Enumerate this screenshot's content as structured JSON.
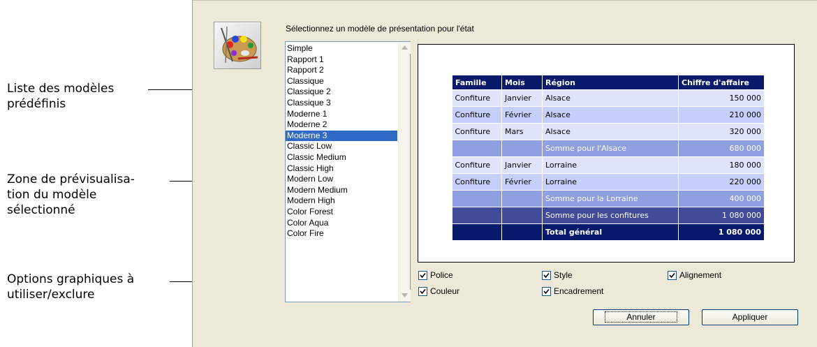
{
  "callouts": {
    "list": [
      "Liste des modèles",
      "prédéfinis"
    ],
    "preview": [
      "Zone de prévisualisa-",
      "tion du modèle",
      "sélectionné"
    ],
    "options": [
      "Options graphiques à",
      "utiliser/exclure"
    ]
  },
  "dialog": {
    "icon": "palette-icon",
    "instruction": "Sélectionnez un modèle de présentation pour l'état",
    "templates": [
      "Simple",
      "Rapport 1",
      "Rapport 2",
      "Classique",
      "Classique 2",
      "Classique 3",
      "Moderne 1",
      "Moderne 2",
      "Moderne 3",
      "Classic Low",
      "Classic Medium",
      "Classic High",
      "Modern Low",
      "Modern Medium",
      "Modern High",
      "Color Forest",
      "Color Aqua",
      "Color Fire"
    ],
    "selected_template": "Moderne 3",
    "preview": {
      "headers": [
        "Famille",
        "Mois",
        "Région",
        "Chiffre d'affaire"
      ],
      "rows": [
        [
          "Confiture",
          "Janvier",
          "Alsace",
          "150 000"
        ],
        [
          "Confiture",
          "Février",
          "Alsace",
          "210 000"
        ],
        [
          "Confiture",
          "Mars",
          "Alsace",
          "320 000"
        ],
        [
          "",
          "",
          "Somme pour l'Alsace",
          "680 000"
        ],
        [
          "Confiture",
          "Janvier",
          "Lorraine",
          "180 000"
        ],
        [
          "Confiture",
          "Février",
          "Lorraine",
          "220 000"
        ],
        [
          "",
          "",
          "Somme pour la Lorraine",
          "400 000"
        ],
        [
          "",
          "",
          "Somme pour les confitures",
          "1 080 000"
        ],
        [
          "",
          "",
          "Total général",
          "1 080 000"
        ]
      ]
    },
    "options": {
      "police": "Police",
      "style": "Style",
      "alignement": "Alignement",
      "couleur": "Couleur",
      "encadrement": "Encadrement"
    },
    "buttons": {
      "cancel": "Annuler",
      "apply": "Appliquer"
    }
  }
}
